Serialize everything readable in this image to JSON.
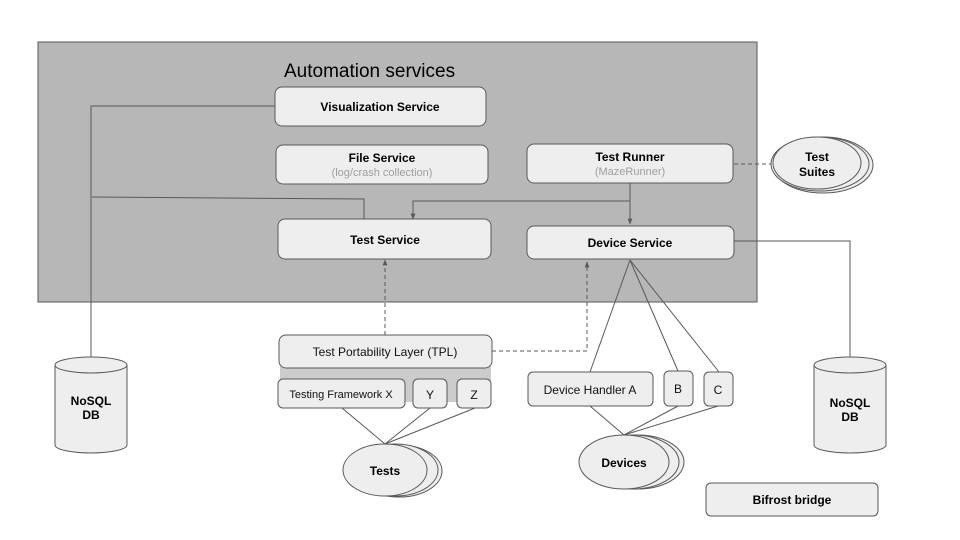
{
  "colors": {
    "container_fill": "#b7b7b7",
    "container_stroke": "#595959",
    "node_fill": "#eeeeee",
    "node_stroke": "#595959",
    "tpl_band_fill": "#cccccc",
    "subtitle_text": "#9e9e9e"
  },
  "container": {
    "title": "Automation services"
  },
  "services": {
    "visualization": {
      "label": "Visualization Service"
    },
    "file": {
      "label": "File Service",
      "sublabel": "(log/crash collection)"
    },
    "test_runner": {
      "label": "Test Runner",
      "sublabel": "(MazeRunner)"
    },
    "test": {
      "label": "Test Service"
    },
    "device": {
      "label": "Device Service"
    }
  },
  "test_suites": {
    "label_line1": "Test",
    "label_line2": "Suites"
  },
  "tpl": {
    "label": "Test Portability Layer (TPL)",
    "frameworks": [
      "Testing Framework X",
      "Y",
      "Z"
    ]
  },
  "tests": {
    "label": "Tests"
  },
  "device_handlers": [
    "Device Handler A",
    "B",
    "C"
  ],
  "devices": {
    "label": "Devices"
  },
  "databases": [
    {
      "line1": "NoSQL",
      "line2": "DB"
    },
    {
      "line1": "NoSQL",
      "line2": "DB"
    }
  ],
  "bifrost": {
    "label": "Bifrost bridge"
  }
}
